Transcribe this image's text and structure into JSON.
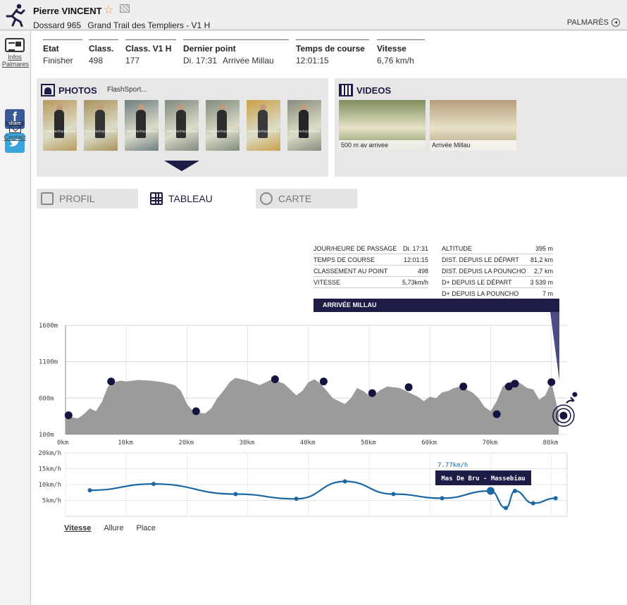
{
  "header": {
    "name": "Pierre VINCENT",
    "bib_label": "Dossard 965",
    "race_label": "Grand Trail des Templiers - V1 H",
    "palmares_label": "PALMARÈS"
  },
  "sidebar": {
    "infos_line1": "Infos",
    "infos_line2": "Palmares",
    "facebook_glyph": "f",
    "facebook_share": "share",
    "contact_label": "Contact"
  },
  "stats": [
    {
      "label": "Etat",
      "value": "Finisher"
    },
    {
      "label": "Class.",
      "value": "498"
    },
    {
      "label": "Class. V1 H",
      "value": "177"
    },
    {
      "label": "Dernier point",
      "value": "Di. 17:31",
      "value2": "Arrivée Millau"
    },
    {
      "label": "Temps de course",
      "value": "12:01:15"
    },
    {
      "label": "Vitesse",
      "value": "6,76 km/h"
    }
  ],
  "photos": {
    "title": "PHOTOS",
    "provider": "FlashSport...",
    "watermark": "www.flashsport.com",
    "thumbs": [
      {
        "bg": "#b79a5e",
        "fg": "#2a2a2a"
      },
      {
        "bg": "#a8935d",
        "fg": "#333333"
      },
      {
        "bg": "#6e7e82",
        "fg": "#2b2b2b"
      },
      {
        "bg": "#7f8a80",
        "fg": "#2e2e2e"
      },
      {
        "bg": "#828b7c",
        "fg": "#2e2e2e"
      },
      {
        "bg": "#c9a04a",
        "fg": "#3a3a3a"
      },
      {
        "bg": "#8a8b7d",
        "fg": "#252525"
      }
    ]
  },
  "videos": {
    "title": "VIDEOS",
    "items": [
      {
        "caption": "500 m av arrivee",
        "bg": "#7d8f5b"
      },
      {
        "caption": "Arrivée Millau",
        "bg": "#b59d7c"
      }
    ]
  },
  "tabs": {
    "profil": "PROFIL",
    "tableau": "TABLEAU",
    "carte": "CARTE"
  },
  "checkpoint": {
    "left": [
      {
        "label": "JOUR/HEURE DE PASSAGE",
        "value": "Di. 17:31"
      },
      {
        "label": "TEMPS DE COURSE",
        "value": "12:01:15"
      },
      {
        "label": "CLASSEMENT AU POINT",
        "value": "498"
      },
      {
        "label": "VITESSE",
        "value": "5,73km/h"
      }
    ],
    "right": [
      {
        "label": "ALTITUDE",
        "value": "395 m"
      },
      {
        "label": "DIST. DEPUIS LE DÉPART",
        "value": "81,2 km"
      },
      {
        "label": "DIST. DEPUIS LA POUNCHO",
        "value": "2,7 km"
      },
      {
        "label": "D+ DEPUIS LE DÉPART",
        "value": "3 539 m"
      },
      {
        "label": "D+ DEPUIS LA POUNCHO",
        "value": "7 m"
      }
    ],
    "name": "ARRIVÉE MILLAU"
  },
  "chart_data": [
    {
      "type": "area",
      "title": "",
      "xlabel": "",
      "ylabel": "",
      "x_ticks": [
        "0km",
        "10km",
        "20km",
        "30km",
        "40km",
        "50km",
        "60km",
        "70km",
        "80km"
      ],
      "y_ticks": [
        "1600m",
        "1100m",
        "600m",
        "100m"
      ],
      "xlim": [
        0,
        81.2
      ],
      "ylim": [
        100,
        1600
      ],
      "color": "#9b9b9b",
      "marker_color": "#141442",
      "profile": [
        [
          0,
          330
        ],
        [
          1,
          340
        ],
        [
          2,
          320
        ],
        [
          3,
          380
        ],
        [
          4,
          460
        ],
        [
          5,
          420
        ],
        [
          6,
          550
        ],
        [
          7,
          760
        ],
        [
          8,
          820
        ],
        [
          9,
          840
        ],
        [
          10,
          830
        ],
        [
          12,
          850
        ],
        [
          14,
          840
        ],
        [
          16,
          820
        ],
        [
          18,
          780
        ],
        [
          19,
          700
        ],
        [
          20,
          520
        ],
        [
          21,
          420
        ],
        [
          22,
          400
        ],
        [
          23,
          390
        ],
        [
          24,
          460
        ],
        [
          25,
          600
        ],
        [
          26,
          700
        ],
        [
          27,
          820
        ],
        [
          28,
          880
        ],
        [
          30,
          840
        ],
        [
          32,
          780
        ],
        [
          34,
          860
        ],
        [
          36,
          800
        ],
        [
          38,
          640
        ],
        [
          39,
          700
        ],
        [
          40,
          820
        ],
        [
          41,
          860
        ],
        [
          42,
          800
        ],
        [
          43,
          700
        ],
        [
          44,
          600
        ],
        [
          45,
          560
        ],
        [
          46,
          520
        ],
        [
          47,
          600
        ],
        [
          48,
          740
        ],
        [
          49,
          700
        ],
        [
          50,
          640
        ],
        [
          51,
          660
        ],
        [
          52,
          720
        ],
        [
          53,
          760
        ],
        [
          55,
          740
        ],
        [
          56,
          700
        ],
        [
          58,
          620
        ],
        [
          59,
          560
        ],
        [
          60,
          620
        ],
        [
          61,
          600
        ],
        [
          62,
          680
        ],
        [
          63,
          700
        ],
        [
          64,
          740
        ],
        [
          65,
          760
        ],
        [
          66,
          720
        ],
        [
          67,
          680
        ],
        [
          68,
          600
        ],
        [
          69,
          480
        ],
        [
          70,
          420
        ],
        [
          71,
          560
        ],
        [
          72,
          760
        ],
        [
          73,
          820
        ],
        [
          74,
          840
        ],
        [
          75,
          800
        ],
        [
          76,
          740
        ],
        [
          77,
          720
        ],
        [
          78,
          580
        ],
        [
          79,
          640
        ],
        [
          80,
          820
        ],
        [
          81.2,
          395
        ]
      ],
      "checkpoints": [
        [
          0.5,
          365
        ],
        [
          7.5,
          830
        ],
        [
          21.5,
          420
        ],
        [
          34.5,
          860
        ],
        [
          42.5,
          830
        ],
        [
          50.5,
          670
        ],
        [
          56.5,
          750
        ],
        [
          65.5,
          760
        ],
        [
          71,
          380
        ],
        [
          73,
          760
        ],
        [
          74,
          800
        ],
        [
          80,
          820
        ],
        [
          82,
          360
        ]
      ]
    },
    {
      "type": "line",
      "title": "",
      "xlabel": "",
      "ylabel": "",
      "y_ticks": [
        "20km/h",
        "15km/h",
        "10km/h",
        "5km/h"
      ],
      "xlim": [
        0,
        81.2
      ],
      "ylim": [
        0,
        20
      ],
      "color": "#1a67a3",
      "series": [
        {
          "values": [
            [
              4,
              8.2
            ],
            [
              14.5,
              10.2
            ],
            [
              28,
              7
            ],
            [
              38,
              5.5
            ],
            [
              46,
              11
            ],
            [
              54,
              7
            ],
            [
              62,
              5.7
            ],
            [
              70,
              8
            ],
            [
              72.5,
              2.6
            ],
            [
              74,
              8
            ],
            [
              77,
              4.1
            ],
            [
              80.7,
              5.7
            ]
          ]
        }
      ],
      "tooltip_value": "7.77km/h",
      "tooltip_label": "Mas De Bru - Massebiau"
    }
  ],
  "speed_tabs": [
    "Vitesse",
    "Allure",
    "Place"
  ]
}
